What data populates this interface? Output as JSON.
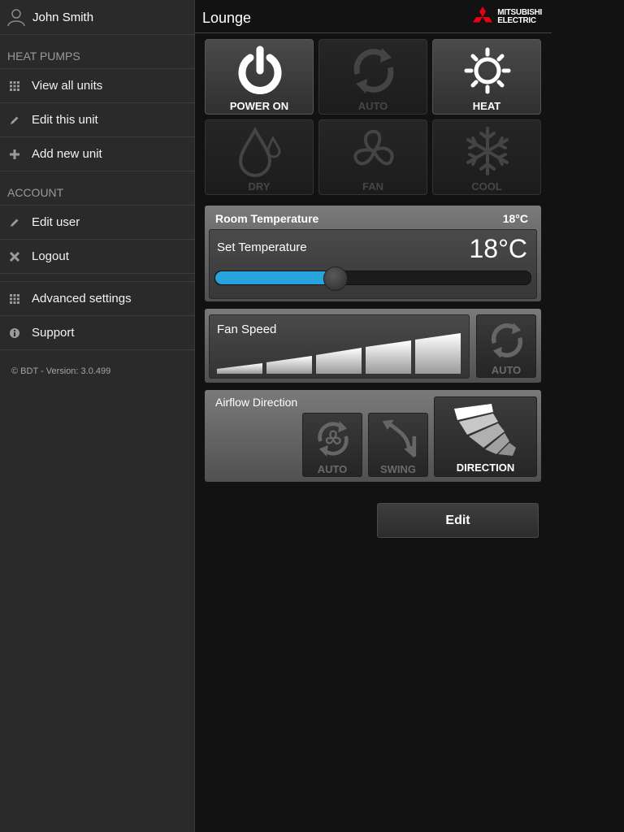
{
  "user": {
    "name": "John Smith"
  },
  "sidebar": {
    "heat_pumps_title": "HEAT PUMPS",
    "heat_pumps_items": [
      {
        "label": "View all units",
        "icon": "grid-icon"
      },
      {
        "label": "Edit this unit",
        "icon": "pencil-icon"
      },
      {
        "label": "Add new unit",
        "icon": "plus-icon"
      }
    ],
    "account_title": "ACCOUNT",
    "account_items": [
      {
        "label": "Edit user",
        "icon": "pencil-icon"
      },
      {
        "label": "Logout",
        "icon": "close-icon"
      }
    ],
    "other_items": [
      {
        "label": "Advanced settings",
        "icon": "grid-icon"
      },
      {
        "label": "Support",
        "icon": "info-icon"
      }
    ],
    "version": "© BDT - Version: 3.0.499"
  },
  "header": {
    "title": "Lounge",
    "brand_line1": "MITSUBISHI",
    "brand_line2": "ELECTRIC"
  },
  "modes": [
    {
      "label": "POWER ON",
      "icon": "power-icon",
      "active": true
    },
    {
      "label": "AUTO",
      "icon": "auto-cycle-icon",
      "active": false
    },
    {
      "label": "HEAT",
      "icon": "sun-icon",
      "active": true
    },
    {
      "label": "DRY",
      "icon": "droplet-icon",
      "active": false
    },
    {
      "label": "FAN",
      "icon": "fan-icon",
      "active": false
    },
    {
      "label": "COOL",
      "icon": "snowflake-icon",
      "active": false
    }
  ],
  "temperature": {
    "room_label": "Room Temperature",
    "room_value": "18°C",
    "set_label": "Set Temperature",
    "set_value": "18°C",
    "slider_fraction": 0.38
  },
  "fan": {
    "label": "Fan Speed",
    "levels": 5,
    "auto_label": "AUTO"
  },
  "airflow": {
    "label": "Airflow Direction",
    "auto_label": "AUTO",
    "swing_label": "SWING",
    "direction_label": "DIRECTION"
  },
  "actions": {
    "edit_label": "Edit"
  },
  "colors": {
    "accent": "#29a3dc",
    "brand_red": "#e60012",
    "inactive_text": "#464646"
  }
}
